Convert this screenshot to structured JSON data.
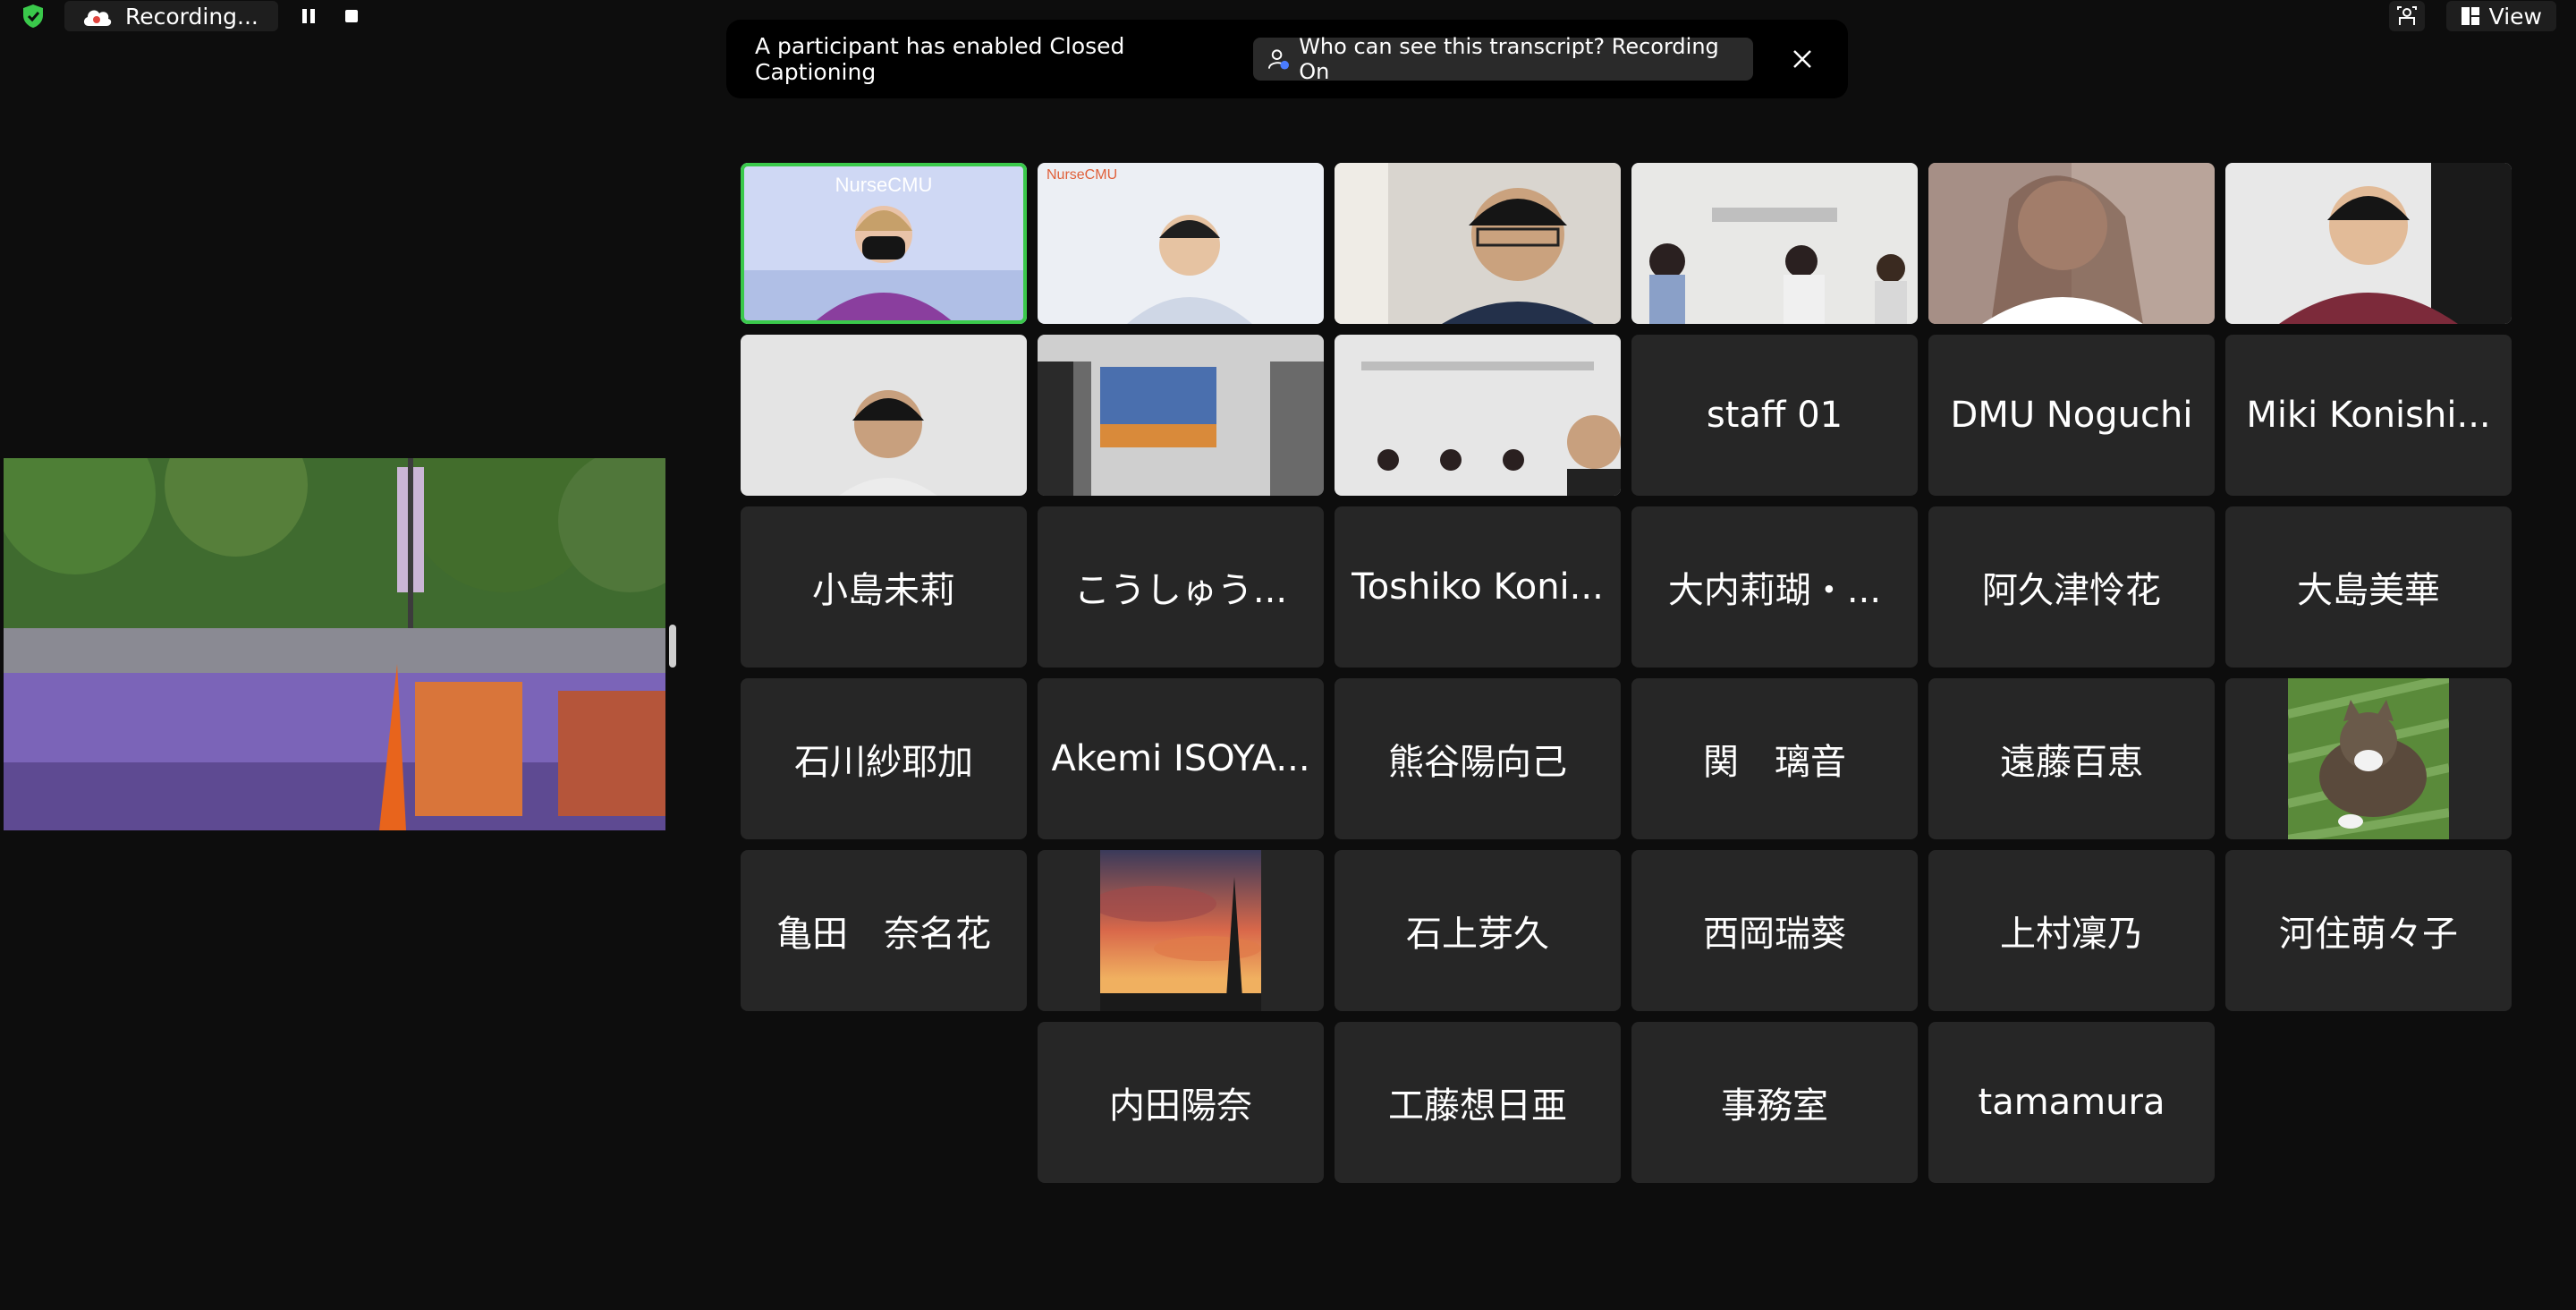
{
  "status": {
    "recording_label": "Recording..."
  },
  "top_right": {
    "view_label": "View"
  },
  "banner": {
    "message": "A participant has enabled Closed Captioning",
    "who_button": "Who can see this transcript? Recording On"
  },
  "shared_screen": {
    "description_icon": "parade-photo"
  },
  "video_tiles": {
    "t0": {
      "overlay_text": "NurseCMU"
    },
    "t1": {
      "overlay_text": "NurseCMU"
    }
  },
  "participants": {
    "p9": "staff 01",
    "p10": "DMU Noguchi",
    "p11": "Miki Konishi...",
    "p12": "小島未莉",
    "p13": "こうしゅう...",
    "p14": "Toshiko Koni...",
    "p15": "大内莉瑚・...",
    "p16": "阿久津怜花",
    "p17": "大島美華",
    "p18": "石川紗耶加",
    "p19": "Akemi ISOYA...",
    "p20": "熊谷陽向己",
    "p21": "関　璃音",
    "p22": "遠藤百恵",
    "p24": "亀田　奈名花",
    "p26": "石上芽久",
    "p27": "西岡瑞葵",
    "p28": "上村凜乃",
    "p29": "河住萌々子",
    "p30": "内田陽奈",
    "p31": "工藤想日亜",
    "p32": "事務室",
    "p33": "tamamura"
  },
  "colors": {
    "active_speaker": "#3ac94b",
    "tile_bg": "#262626",
    "record_shield": "#3ac94b"
  }
}
